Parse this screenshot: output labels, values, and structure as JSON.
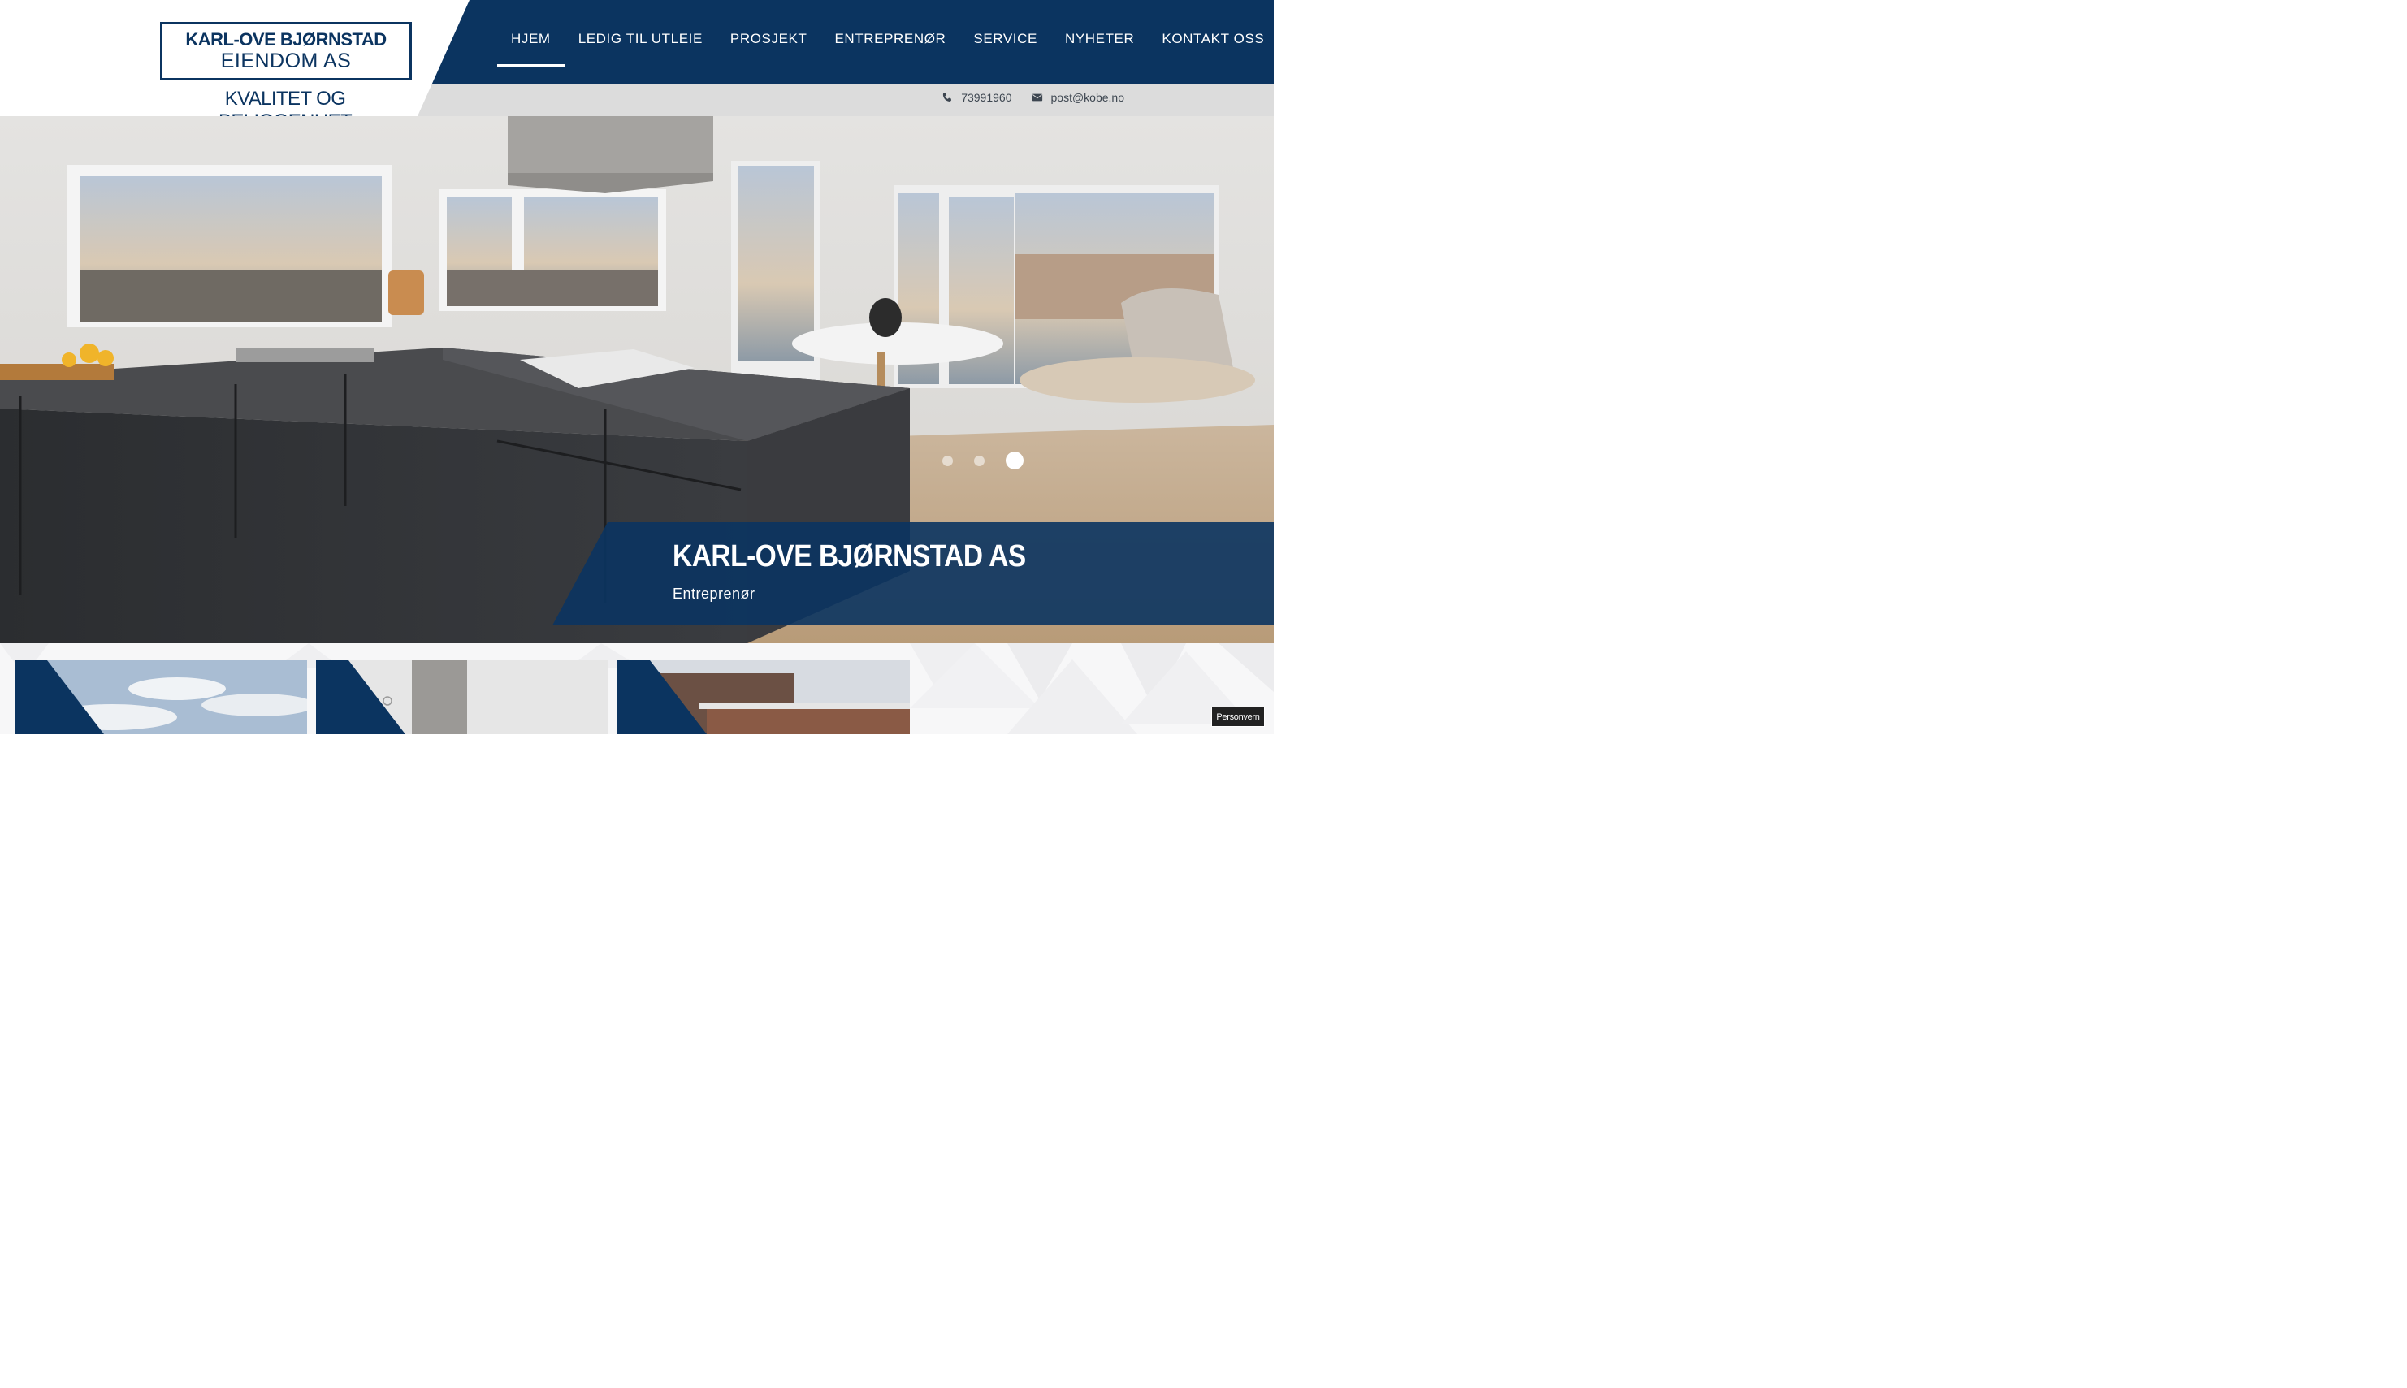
{
  "brand": {
    "logo_line1": "KARL-OVE BJØRNSTAD",
    "logo_line2": "EIENDOM  AS",
    "tagline": "KVALITET OG BELIGGENHET"
  },
  "nav": {
    "items": [
      {
        "label": "HJEM",
        "active": true
      },
      {
        "label": "LEDIG TIL UTLEIE",
        "active": false
      },
      {
        "label": "PROSJEKT",
        "active": false
      },
      {
        "label": "ENTREPRENØR",
        "active": false
      },
      {
        "label": "SERVICE",
        "active": false
      },
      {
        "label": "NYHETER",
        "active": false
      },
      {
        "label": "KONTAKT OSS",
        "active": false
      }
    ]
  },
  "contact": {
    "phone_icon": "phone-icon",
    "phone": "73991960",
    "email_icon": "envelope-icon",
    "email": "post@kobe.no"
  },
  "hero": {
    "title": "KARL-OVE BJØRNSTAD AS",
    "subtitle": "Entreprenør",
    "slide_count": 3,
    "active_slide": 3
  },
  "privacy_button": "Personvern",
  "colors": {
    "brand_blue": "#0b3460",
    "contact_band": "#dcdcdc"
  }
}
